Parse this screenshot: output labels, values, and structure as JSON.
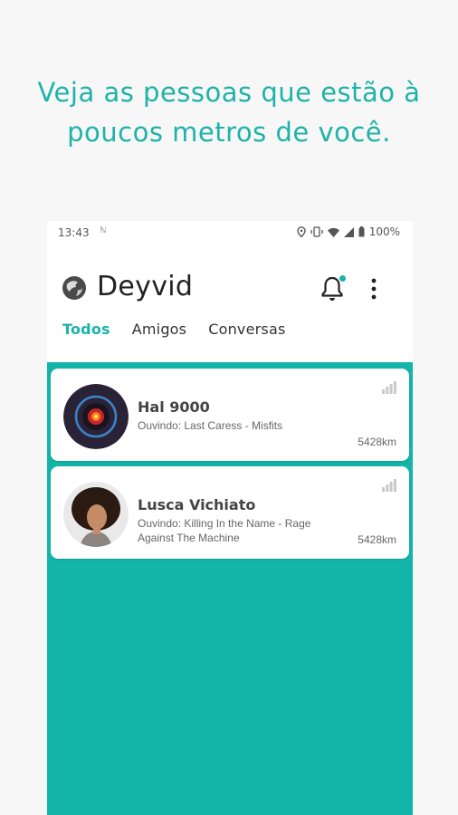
{
  "headline": {
    "line1": "Veja as pessoas que estão à",
    "line2": "poucos metros de você."
  },
  "statusbar": {
    "time": "13:43",
    "battery": "100%"
  },
  "app": {
    "title": "Deyvid"
  },
  "tabs": [
    {
      "label": "Todos",
      "active": true
    },
    {
      "label": "Amigos",
      "active": false
    },
    {
      "label": "Conversas",
      "active": false
    }
  ],
  "users": [
    {
      "name": "Hal 9000",
      "listening": "Ouvindo: Last Caress - Misfits",
      "distance": "5428km"
    },
    {
      "name": "Lusca Vichiato",
      "listening": "Ouvindo: Killing In the Name - Rage Against The Machine",
      "distance": "5428km"
    }
  ],
  "colors": {
    "accent": "#19b3a8",
    "background_green": "#13b5a9"
  }
}
